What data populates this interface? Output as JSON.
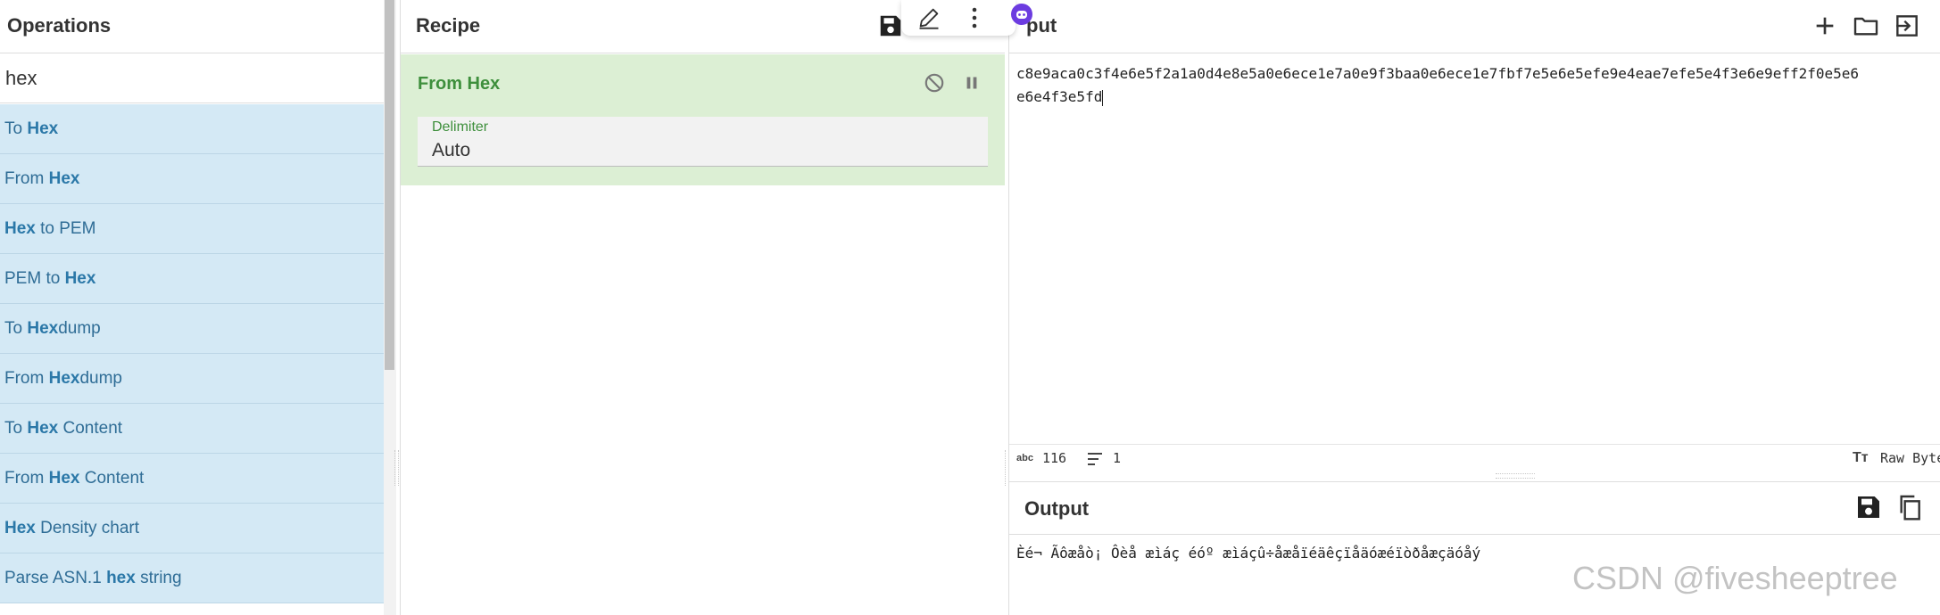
{
  "operations": {
    "title": "Operations",
    "search_value": "hex",
    "items": [
      {
        "pre": "To ",
        "match": "Hex",
        "post": ""
      },
      {
        "pre": "From ",
        "match": "Hex",
        "post": ""
      },
      {
        "pre": "",
        "match": "Hex",
        "post": " to PEM"
      },
      {
        "pre": "PEM to ",
        "match": "Hex",
        "post": ""
      },
      {
        "pre": "To ",
        "match": "Hex",
        "post": "dump"
      },
      {
        "pre": "From ",
        "match": "Hex",
        "post": "dump"
      },
      {
        "pre": "To ",
        "match": "Hex",
        "post": " Content"
      },
      {
        "pre": "From ",
        "match": "Hex",
        "post": " Content"
      },
      {
        "pre": "",
        "match": "Hex",
        "post": " Density chart"
      },
      {
        "pre": "Parse ASN.1 ",
        "match": "hex",
        "post": " string"
      }
    ]
  },
  "recipe": {
    "title": "Recipe",
    "operation": {
      "name": "From Hex",
      "delimiter_label": "Delimiter",
      "delimiter_value": "Auto"
    }
  },
  "input": {
    "title_visible": "put",
    "text_line1": "c8e9aca0c3f4e6e5f2a1a0d4e8e5a0e6ece1e7a0e9f3baa0e6ece1e7fbf7e5e6e5efe9e4eae7efe5e4f3e6e9eff2f0e5e6",
    "text_line2": "e6e4f3e5fd",
    "status": {
      "length": "116",
      "lines": "1",
      "raw_label": "Raw Byte"
    }
  },
  "output": {
    "title": "Output",
    "text": "Èé¬ Ãôæåò¡ Ôèå æìáç éóº æìáçû÷åæåïéäêçïåäóæéïòðåæçäóåý"
  },
  "watermark": "CSDN @fivesheeptree",
  "colors": {
    "op_item_bg": "#d4e9f5",
    "op_item_text": "#2f6d96",
    "recipe_op_bg": "#dcefd4",
    "recipe_op_title": "#3e8f3c",
    "bot_icon": "#6c3ce0"
  }
}
